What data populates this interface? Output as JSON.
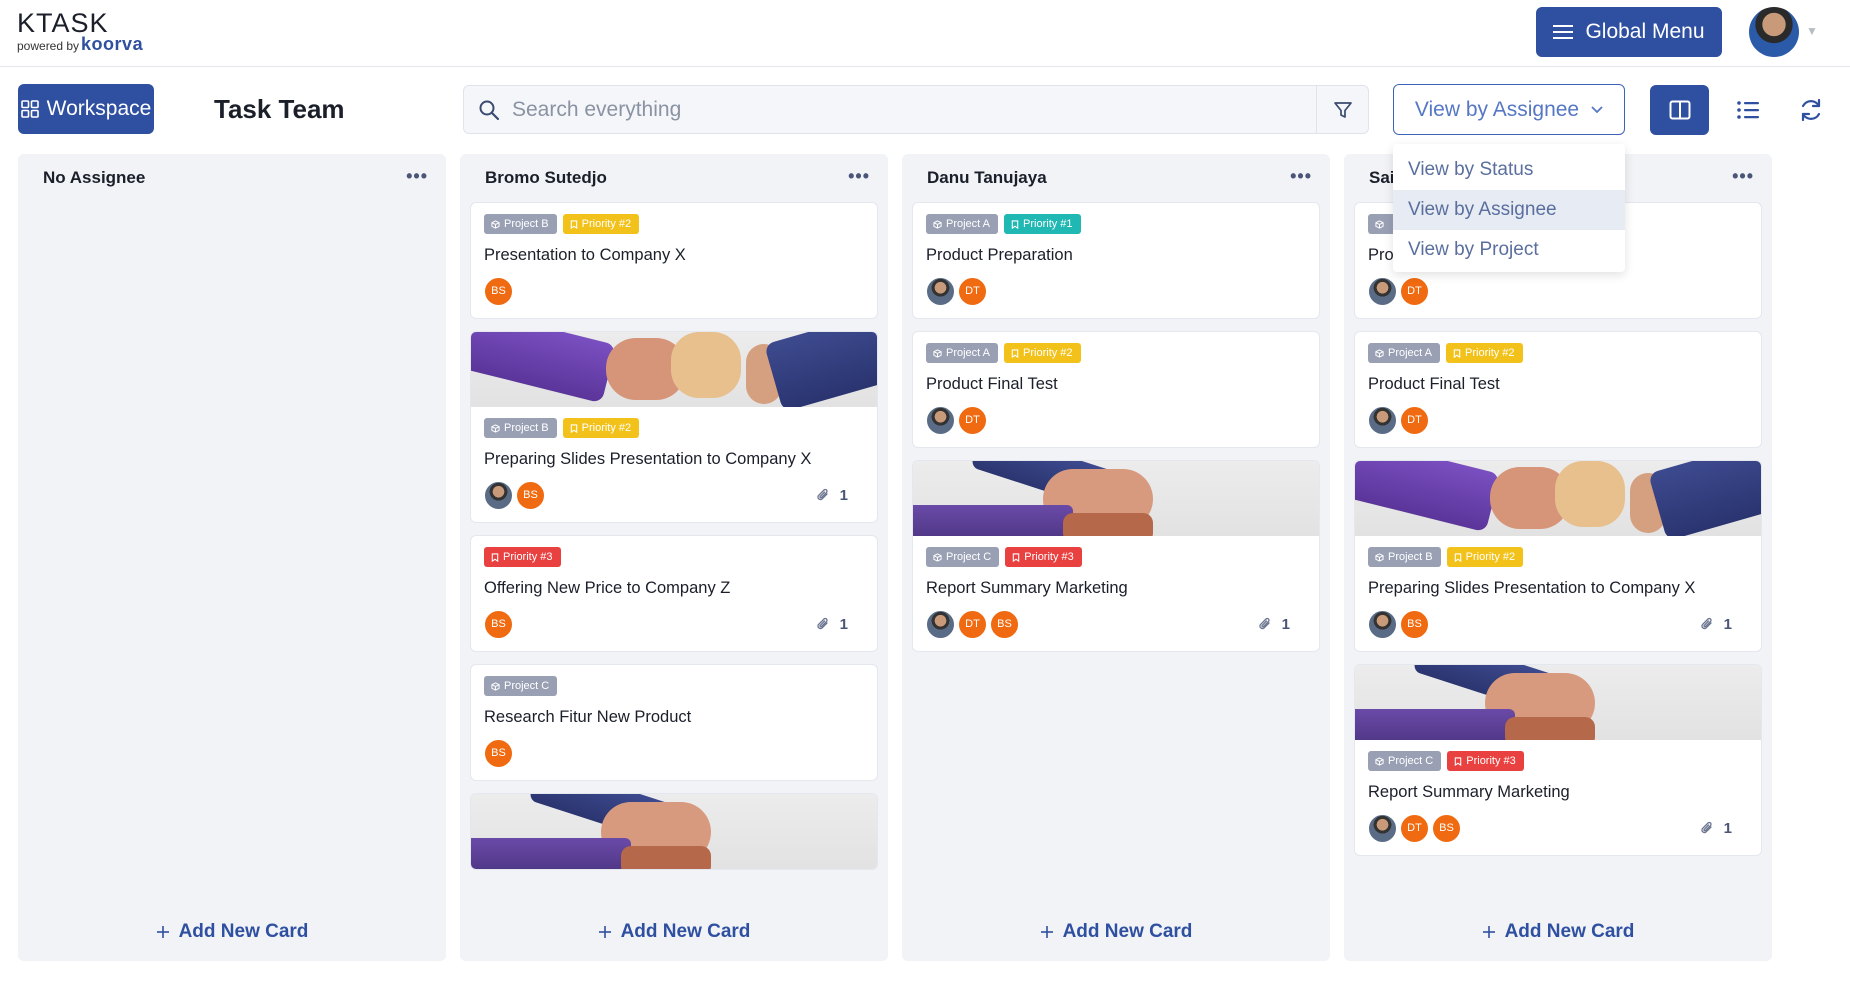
{
  "app": {
    "logo": "KTASK",
    "powered_by": "powered by",
    "brand": "koorva"
  },
  "header": {
    "global_menu_label": "Global Menu"
  },
  "toolbar": {
    "workspace_label": "Workspace",
    "team_title": "Task Team",
    "search_placeholder": "Search everything",
    "view_selected": "View by Assignee"
  },
  "dropdown": {
    "options": [
      "View by Status",
      "View by Assignee",
      "View by Project"
    ],
    "active_index": 1
  },
  "colors": {
    "primary": "#2f50a1",
    "priority_1": "#20b8b3",
    "priority_2": "#f3c21a",
    "priority_3": "#e84140",
    "project_tag": "#9aa0b4",
    "initials_avatar": "#ef6a10"
  },
  "columns": [
    {
      "title": "No Assignee",
      "add_label": "Add New Card",
      "cards": []
    },
    {
      "title": "Bromo Sutedjo",
      "add_label": "Add New Card",
      "cards": [
        {
          "cover": "",
          "tags": [
            {
              "label": "Project B",
              "kind": "project"
            },
            {
              "label": "Priority #2",
              "kind": "p2"
            }
          ],
          "title": "Presentation to Company X",
          "avatars": [
            {
              "kind": "initials",
              "text": "BS"
            }
          ],
          "attachments": ""
        },
        {
          "cover": "fistbump",
          "tags": [
            {
              "label": "Project B",
              "kind": "project"
            },
            {
              "label": "Priority #2",
              "kind": "p2"
            }
          ],
          "title": "Preparing Slides Presentation to Company X",
          "avatars": [
            {
              "kind": "photo",
              "text": ""
            },
            {
              "kind": "initials",
              "text": "BS"
            }
          ],
          "attachments": "1"
        },
        {
          "cover": "",
          "tags": [
            {
              "label": "Priority #3",
              "kind": "p3"
            }
          ],
          "title": "Offering New Price to Company Z",
          "avatars": [
            {
              "kind": "initials",
              "text": "BS"
            }
          ],
          "attachments": "1"
        },
        {
          "cover": "",
          "tags": [
            {
              "label": "Project C",
              "kind": "project"
            }
          ],
          "title": "Research Fitur New Product",
          "avatars": [
            {
              "kind": "initials",
              "text": "BS"
            }
          ],
          "attachments": ""
        },
        {
          "cover": "hands",
          "tags": [],
          "title": "",
          "avatars": [],
          "attachments": ""
        }
      ]
    },
    {
      "title": "Danu Tanujaya",
      "add_label": "Add New Card",
      "cards": [
        {
          "cover": "",
          "tags": [
            {
              "label": "Project A",
              "kind": "project"
            },
            {
              "label": "Priority #1",
              "kind": "p1"
            }
          ],
          "title": "Product Preparation",
          "avatars": [
            {
              "kind": "photo",
              "text": ""
            },
            {
              "kind": "initials",
              "text": "DT"
            }
          ],
          "attachments": ""
        },
        {
          "cover": "",
          "tags": [
            {
              "label": "Project A",
              "kind": "project"
            },
            {
              "label": "Priority #2",
              "kind": "p2"
            }
          ],
          "title": "Product Final Test",
          "avatars": [
            {
              "kind": "photo",
              "text": ""
            },
            {
              "kind": "initials",
              "text": "DT"
            }
          ],
          "attachments": ""
        },
        {
          "cover": "hands",
          "tags": [
            {
              "label": "Project C",
              "kind": "project"
            },
            {
              "label": "Priority #3",
              "kind": "p3"
            }
          ],
          "title": "Report Summary Marketing",
          "avatars": [
            {
              "kind": "photo",
              "text": ""
            },
            {
              "kind": "initials",
              "text": "DT"
            },
            {
              "kind": "initials",
              "text": "BS"
            }
          ],
          "attachments": "1"
        }
      ]
    },
    {
      "title": "Sai",
      "add_label": "Add New Card",
      "cards": [
        {
          "cover": "",
          "tags": [
            {
              "label": "",
              "kind": "project"
            }
          ],
          "title": "Pro",
          "avatars": [
            {
              "kind": "photo",
              "text": ""
            },
            {
              "kind": "initials",
              "text": "DT"
            }
          ],
          "attachments": ""
        },
        {
          "cover": "",
          "tags": [
            {
              "label": "Project A",
              "kind": "project"
            },
            {
              "label": "Priority #2",
              "kind": "p2"
            }
          ],
          "title": "Product Final Test",
          "avatars": [
            {
              "kind": "photo",
              "text": ""
            },
            {
              "kind": "initials",
              "text": "DT"
            }
          ],
          "attachments": ""
        },
        {
          "cover": "fistbump",
          "tags": [
            {
              "label": "Project B",
              "kind": "project"
            },
            {
              "label": "Priority #2",
              "kind": "p2"
            }
          ],
          "title": "Preparing Slides Presentation to Company X",
          "avatars": [
            {
              "kind": "photo",
              "text": ""
            },
            {
              "kind": "initials",
              "text": "BS"
            }
          ],
          "attachments": "1"
        },
        {
          "cover": "hands",
          "tags": [
            {
              "label": "Project C",
              "kind": "project"
            },
            {
              "label": "Priority #3",
              "kind": "p3"
            }
          ],
          "title": "Report Summary Marketing",
          "avatars": [
            {
              "kind": "photo",
              "text": ""
            },
            {
              "kind": "initials",
              "text": "DT"
            },
            {
              "kind": "initials",
              "text": "BS"
            }
          ],
          "attachments": "1"
        }
      ]
    }
  ]
}
